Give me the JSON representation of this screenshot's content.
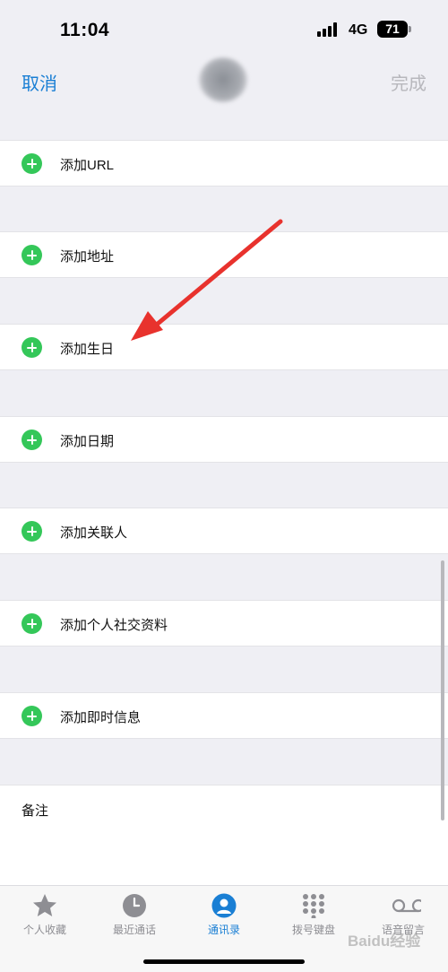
{
  "status_bar": {
    "time": "11:04",
    "network": "4G",
    "battery": "71"
  },
  "nav": {
    "cancel_label": "取消",
    "done_label": "完成"
  },
  "rows": [
    {
      "label": "添加URL"
    },
    {
      "label": "添加地址"
    },
    {
      "label": "添加生日"
    },
    {
      "label": "添加日期"
    },
    {
      "label": "添加关联人"
    },
    {
      "label": "添加个人社交资料"
    },
    {
      "label": "添加即时信息"
    }
  ],
  "notes": {
    "label": "备注"
  },
  "tabs": [
    {
      "label": "个人收藏",
      "icon": "star-icon"
    },
    {
      "label": "最近通话",
      "icon": "clock-icon"
    },
    {
      "label": "通讯录",
      "icon": "contacts-icon",
      "active": true
    },
    {
      "label": "拨号键盘",
      "icon": "keypad-icon"
    },
    {
      "label": "语音留言",
      "icon": "voicemail-icon"
    }
  ],
  "watermark": "Baidu经验",
  "colors": {
    "accent": "#1a7fd4",
    "add_button": "#34c759",
    "arrow": "#e8322d"
  }
}
